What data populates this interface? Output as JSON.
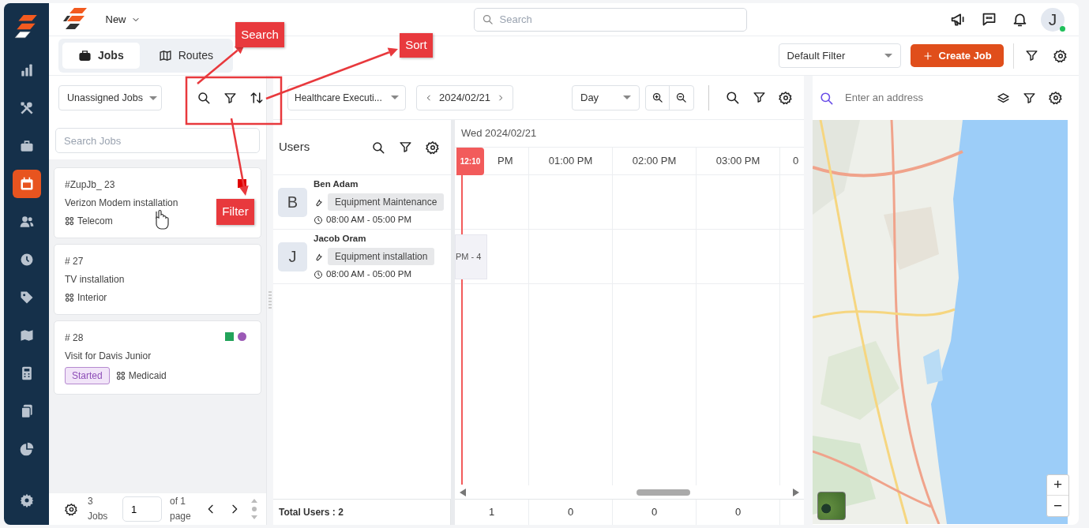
{
  "sidebar": {
    "items": [
      {
        "selected": false
      },
      {
        "selected": false
      },
      {
        "selected": false
      },
      {
        "selected": true
      },
      {
        "selected": false
      },
      {
        "selected": false
      },
      {
        "selected": false
      },
      {
        "selected": false
      },
      {
        "selected": false
      },
      {
        "selected": false
      },
      {
        "selected": false
      }
    ]
  },
  "header": {
    "menu": "New",
    "search_placeholder": "Search",
    "avatar": "J",
    "online": true
  },
  "view_tabs": [
    {
      "label": "Jobs",
      "selected": true
    },
    {
      "label": "Routes",
      "selected": false
    }
  ],
  "filter_select": "Default Filter",
  "create_button": "Create Job",
  "jobs_panel": {
    "list_select": "Unassigned Jobs",
    "search_placeholder": "Search Jobs",
    "jobs": [
      {
        "number": "#ZupJb_ 23",
        "title": "Verizon Modem installation",
        "category": "Telecom",
        "markers": [
          {
            "kind": "square",
            "color": "#e00000"
          }
        ]
      },
      {
        "number": "# 27",
        "title": "TV installation",
        "category": "Interior"
      },
      {
        "number": "# 28",
        "title": "Visit for Davis Junior",
        "status": "Started",
        "category": "Medicaid",
        "markers": [
          {
            "kind": "square",
            "color": "#22a35a"
          },
          {
            "kind": "circle",
            "color": "#9b59b6"
          }
        ]
      }
    ],
    "footer": {
      "count": "3 Jobs",
      "page": "1",
      "pages": "of 1 page"
    }
  },
  "scheduler": {
    "team_select": "Healthcare Executi...",
    "date": "2024/02/21",
    "view_select": "Day",
    "users_title": "Users",
    "day_label": "Wed 2024/02/21",
    "now_marker": "12:10",
    "time_columns": [
      "PM",
      "01:00 PM",
      "02:00 PM",
      "03:00 PM",
      "0"
    ],
    "users": [
      {
        "name": "Ben Adam",
        "initial": "B",
        "skill": "Equipment Maintenance",
        "hours": "08:00 AM - 05:00 PM"
      },
      {
        "name": "Jacob Oram",
        "initial": "J",
        "skill": "Equipment installation",
        "hours": "08:00 AM - 05:00 PM",
        "events": [
          {
            "text": "PM - 4"
          }
        ]
      }
    ],
    "total_label": "Total Users : 2",
    "totals": [
      "1",
      "0",
      "0",
      "0"
    ]
  },
  "map": {
    "address_placeholder": "Enter an address",
    "zoom_in": "+",
    "zoom_out": "−"
  },
  "annotations": [
    {
      "label": "Search"
    },
    {
      "label": "Sort"
    },
    {
      "label": "Filter"
    }
  ]
}
